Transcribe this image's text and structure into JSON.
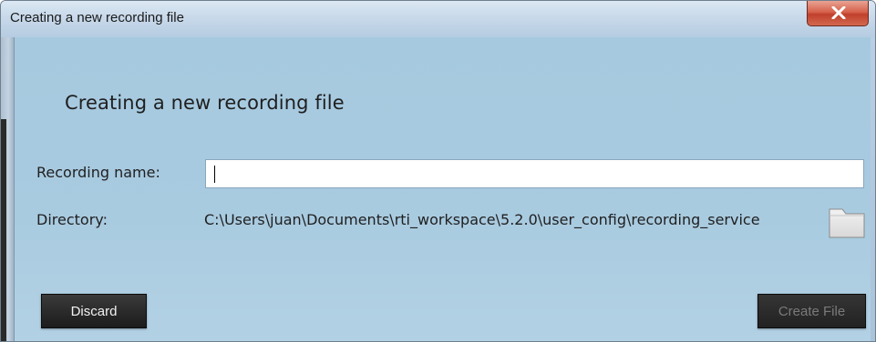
{
  "window": {
    "title": "Creating a new recording file"
  },
  "dialog": {
    "heading": "Creating a new recording file",
    "recording_name_label": "Recording name:",
    "recording_name_value": "",
    "directory_label": "Directory:",
    "directory_value": "C:\\Users\\juan\\Documents\\rti_workspace\\5.2.0\\user_config\\recording_service",
    "discard_label": "Discard",
    "create_label": "Create File"
  },
  "icons": {
    "close": "close-icon",
    "folder": "folder-icon"
  },
  "colors": {
    "content_bg": "#a9cbe0",
    "close_button": "#c7432f",
    "button_dark": "#262626",
    "disabled_text": "#7a7a7a"
  }
}
